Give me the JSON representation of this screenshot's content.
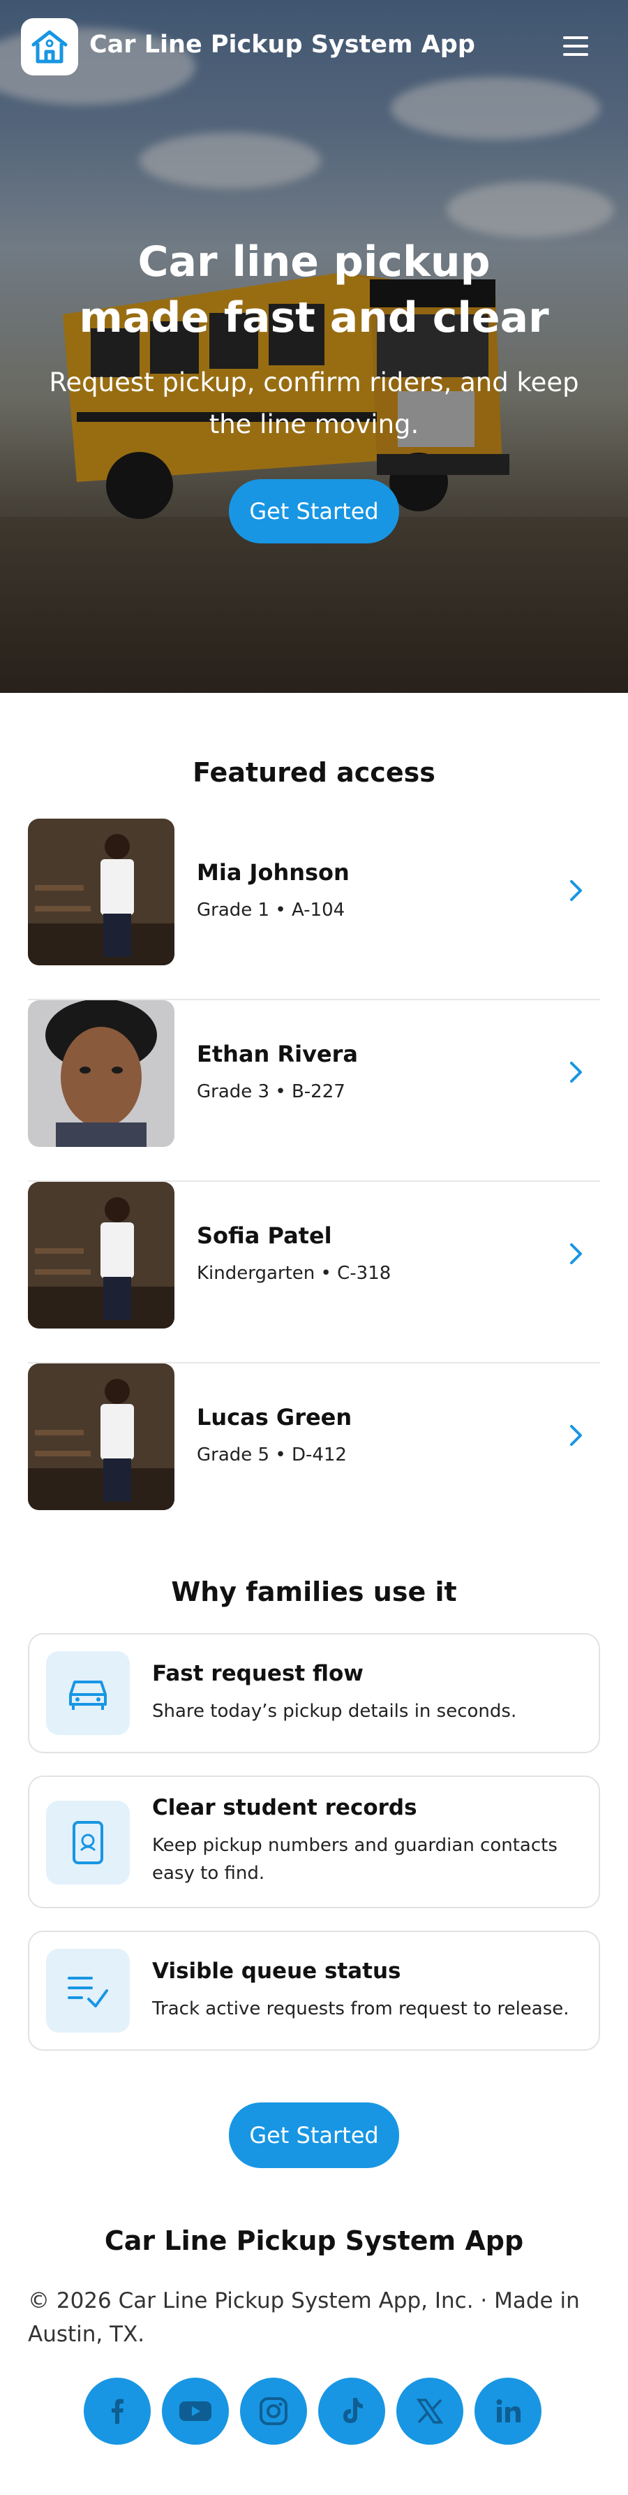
{
  "header": {
    "app_title": "Car Line Pickup System App",
    "logo_icon": "school-icon",
    "menu_icon": "hamburger-menu-icon"
  },
  "hero": {
    "title_line1": "Car line pickup",
    "title_line2": "made fast and clear",
    "subtitle": "Request pickup, confirm riders, and keep the line moving.",
    "cta_label": "Get Started"
  },
  "featured": {
    "title": "Featured access",
    "items": [
      {
        "name": "Mia Johnson",
        "meta": "Grade 1 • A-104"
      },
      {
        "name": "Ethan Rivera",
        "meta": "Grade 3 • B-227"
      },
      {
        "name": "Sofia Patel",
        "meta": "Kindergarten • C-318"
      },
      {
        "name": "Lucas Green",
        "meta": "Grade 5 • D-412"
      }
    ]
  },
  "why": {
    "title": "Why families use it",
    "cards": [
      {
        "icon": "car-icon",
        "title": "Fast request flow",
        "desc": "Share today’s pickup details in seconds."
      },
      {
        "icon": "student-record-icon",
        "title": "Clear student records",
        "desc": "Keep pickup numbers and guardian contacts easy to find."
      },
      {
        "icon": "checklist-icon",
        "title": "Visible queue status",
        "desc": "Track active requests from request to release."
      }
    ]
  },
  "cta_label": "Get Started",
  "footer": {
    "title": "Car Line Pickup System App",
    "copyright": "© 2026 Car Line Pickup System App, Inc. · Made in Austin, TX.",
    "socials": [
      "facebook-icon",
      "youtube-icon",
      "instagram-icon",
      "tiktok-icon",
      "x-icon",
      "linkedin-icon"
    ]
  },
  "colors": {
    "accent": "#1896e3",
    "accent_light": "#e3f1fb"
  }
}
